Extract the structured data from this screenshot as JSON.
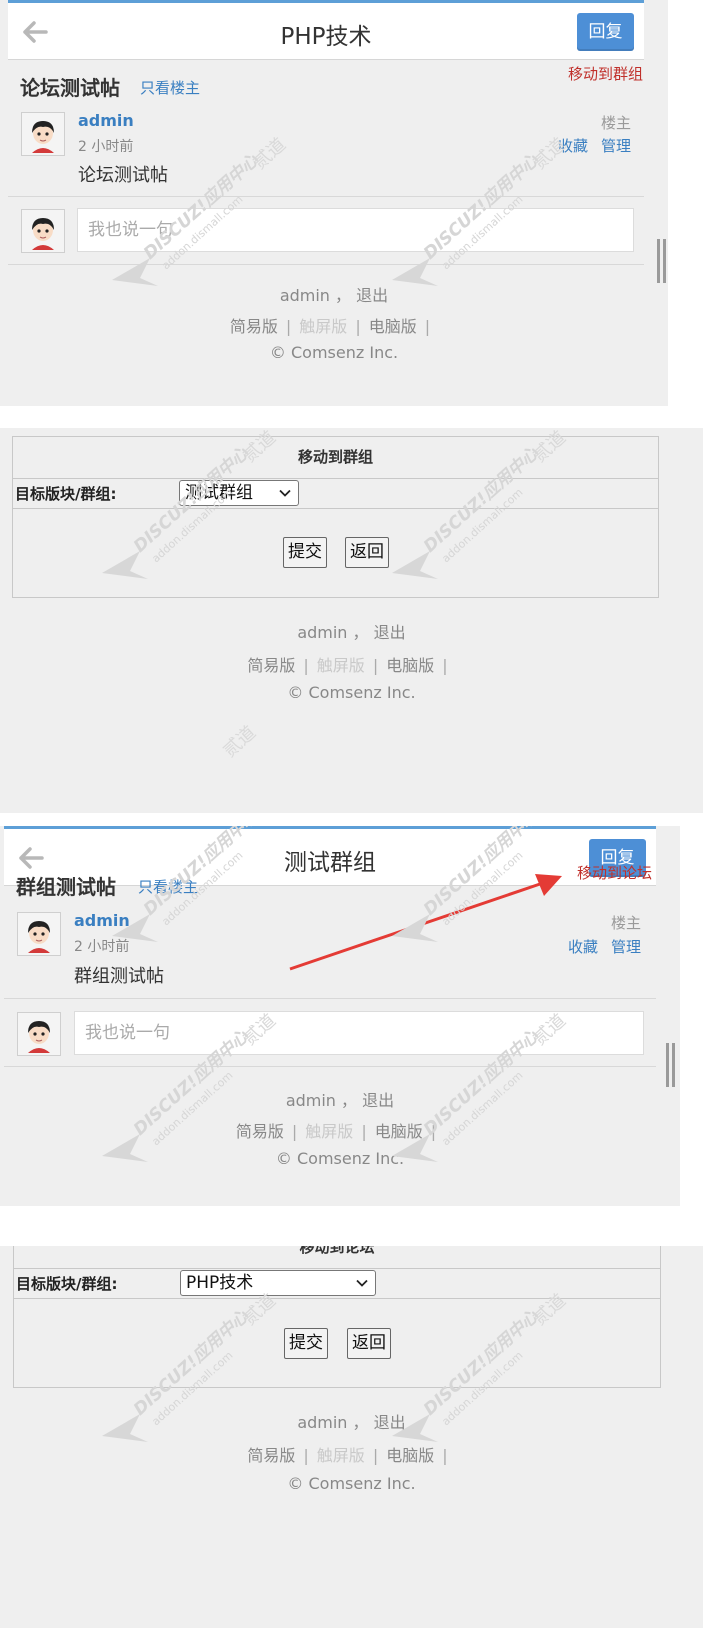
{
  "panel_forum_thread": {
    "forum_name": "PHP技术",
    "reply_button": "回复",
    "move_action": "移动到群组",
    "thread_title": "论坛测试帖",
    "only_author_link": "只看楼主",
    "author": "admin",
    "post_time": "2 小时前",
    "floor_label": "楼主",
    "favorite_link": "收藏",
    "manage_link": "管理",
    "post_content": "论坛测试帖",
    "reply_placeholder": "我也说一句"
  },
  "panel_move_to_group": {
    "heading": "移动到群组",
    "target_label": "目标版块/群组:",
    "selected_target": "测试群组",
    "submit_button": "提交",
    "back_button": "返回"
  },
  "panel_group_thread": {
    "group_name": "测试群组",
    "reply_button": "回复",
    "move_action": "移动到论坛",
    "thread_title": "群组测试帖",
    "only_author_link": "只看楼主",
    "author": "admin",
    "post_time": "2 小时前",
    "floor_label": "楼主",
    "favorite_link": "收藏",
    "manage_link": "管理",
    "post_content": "群组测试帖",
    "reply_placeholder": "我也说一句"
  },
  "panel_move_to_forum": {
    "heading": "移动到论坛",
    "target_label": "目标版块/群组:",
    "selected_target": "PHP技术",
    "submit_button": "提交",
    "back_button": "返回"
  },
  "footer": {
    "username": "admin",
    "comma": "，",
    "logout": "退出",
    "simple_version": "简易版",
    "touch_version": "触屏版",
    "desktop_version": "电脑版",
    "separator": "|",
    "copyright": "© Comsenz Inc."
  },
  "watermark": {
    "brand": "DISCUZ!应用中心",
    "domain": "addon.dismall.com",
    "mark": "贰道"
  },
  "colors": {
    "accent_blue": "#4d8fd6",
    "link_blue": "#3a7fc1",
    "move_red": "#c0302b",
    "annotation_arrow": "#e43b35",
    "page_background": "#efefef"
  }
}
